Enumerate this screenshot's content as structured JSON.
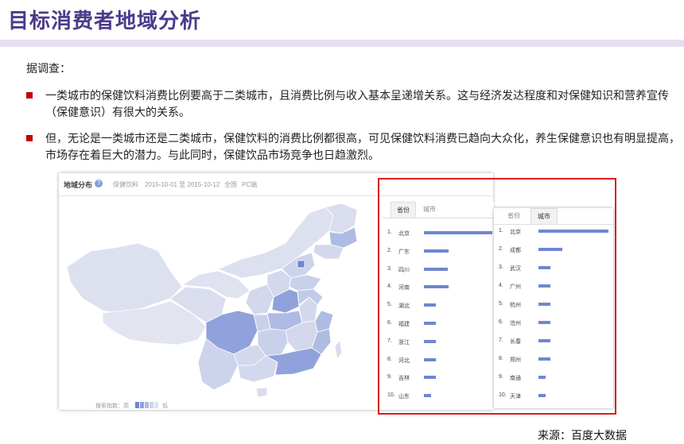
{
  "header": {
    "title": "目标消费者地域分析"
  },
  "body": {
    "intro": "据调查：",
    "bullets": [
      "一类城市的保健饮料消费比例要高于二类城市，且消费比例与收入基本呈递增关系。这与经济发达程度和对保健知识和营养宣传（保健意识）有很大的关系。",
      "但，无论是一类城市还是二类城市，保健饮料的消费比例都很高，可见保健饮料消费已趋向大众化，养生保健意识也有明显提高，市场存在着巨大的潜力。与此同时，保健饮品市场竞争也日趋激烈。"
    ]
  },
  "map_card": {
    "title": "地域分布",
    "help_icon": "?",
    "keyword": "保健饮料",
    "date_range": "2015-10-01 至 2015-10-12",
    "region": "全国",
    "device": "PC端",
    "legend_label": "搜索指数：高",
    "legend_low": "低",
    "colors": {
      "light": "#dfe2ef",
      "mid": "#a9b7e2",
      "dark": "#7f95d6",
      "accent": "#6f86d0"
    }
  },
  "province_panel": {
    "tabs": [
      "省份",
      "城市"
    ],
    "active_tab": 0,
    "rows": [
      {
        "rank": "1.",
        "name": "北京",
        "value": 100
      },
      {
        "rank": "2.",
        "name": "广东",
        "value": 36
      },
      {
        "rank": "3.",
        "name": "四川",
        "value": 35
      },
      {
        "rank": "4.",
        "name": "河南",
        "value": 36
      },
      {
        "rank": "5.",
        "name": "湖北",
        "value": 18
      },
      {
        "rank": "6.",
        "name": "福建",
        "value": 17
      },
      {
        "rank": "7.",
        "name": "浙江",
        "value": 17
      },
      {
        "rank": "8.",
        "name": "河北",
        "value": 17
      },
      {
        "rank": "9.",
        "name": "吉林",
        "value": 17
      },
      {
        "rank": "10.",
        "name": "山东",
        "value": 10
      }
    ]
  },
  "city_panel": {
    "tabs": [
      "省份",
      "城市"
    ],
    "active_tab": 1,
    "rows": [
      {
        "rank": "1.",
        "name": "北京",
        "value": 100
      },
      {
        "rank": "2.",
        "name": "成都",
        "value": 34
      },
      {
        "rank": "3.",
        "name": "武汉",
        "value": 17
      },
      {
        "rank": "4.",
        "name": "广州",
        "value": 17
      },
      {
        "rank": "5.",
        "name": "杭州",
        "value": 17
      },
      {
        "rank": "6.",
        "name": "沧州",
        "value": 17
      },
      {
        "rank": "7.",
        "name": "长春",
        "value": 17
      },
      {
        "rank": "8.",
        "name": "郑州",
        "value": 17
      },
      {
        "rank": "9.",
        "name": "南通",
        "value": 10
      },
      {
        "rank": "10.",
        "name": "天津",
        "value": 10
      }
    ]
  },
  "source": "来源：百度大数据"
}
